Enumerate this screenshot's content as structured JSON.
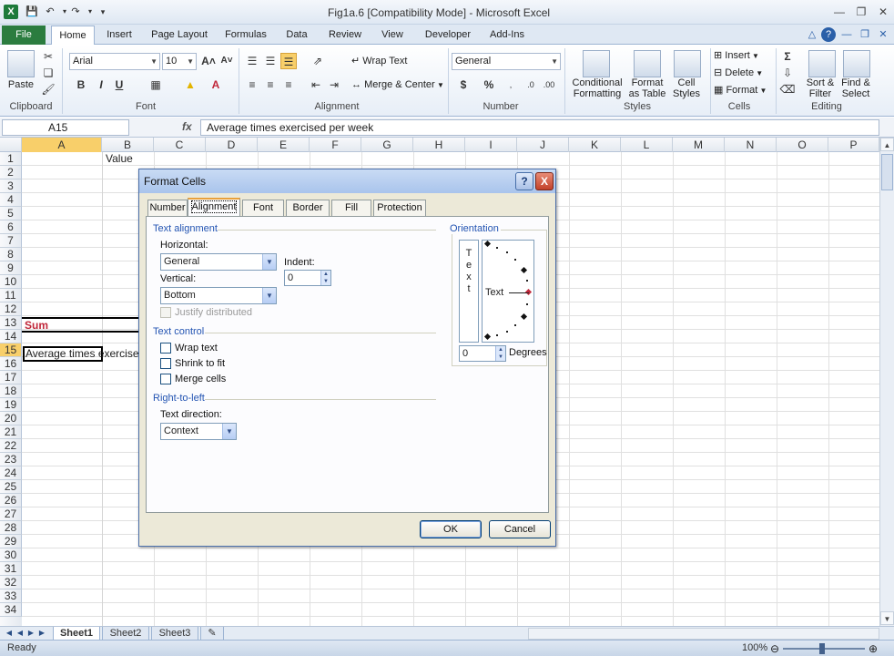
{
  "window": {
    "title": "Fig1a.6  [Compatibility Mode]  -  Microsoft Excel",
    "app_icon": "X"
  },
  "ribbon": {
    "file_tab": "File",
    "tabs": [
      "Home",
      "Insert",
      "Page Layout",
      "Formulas",
      "Data",
      "Review",
      "View",
      "Developer",
      "Add-Ins"
    ],
    "active_tab": "Home",
    "clipboard": {
      "paste": "Paste",
      "label": "Clipboard"
    },
    "font": {
      "name": "Arial",
      "size": "10",
      "label": "Font",
      "bold": "B",
      "italic": "I",
      "underline": "U"
    },
    "alignment": {
      "wrap_text": "Wrap Text",
      "merge_center": "Merge & Center",
      "label": "Alignment"
    },
    "number": {
      "format": "General",
      "currency": "$",
      "percent": "%",
      "label": "Number"
    },
    "styles": {
      "conditional": [
        "Conditional",
        "Formatting"
      ],
      "format_table": [
        "Format",
        "as Table"
      ],
      "cell_styles": [
        "Cell",
        "Styles"
      ],
      "label": "Styles"
    },
    "cells": {
      "insert": "Insert",
      "delete": "Delete",
      "format": "Format",
      "label": "Cells"
    },
    "editing": {
      "sort": [
        "Sort &",
        "Filter"
      ],
      "find": [
        "Find &",
        "Select"
      ],
      "label": "Editing"
    }
  },
  "formula_bar": {
    "name_box": "A15",
    "fx": "fx",
    "value": "Average times exercised per week"
  },
  "grid": {
    "columns": [
      "A",
      "B",
      "C",
      "D",
      "E",
      "F",
      "G",
      "H",
      "I",
      "J",
      "K",
      "L",
      "M",
      "N",
      "O",
      "P"
    ],
    "selected_column": "A",
    "rows": [
      "1",
      "2",
      "3",
      "4",
      "5",
      "6",
      "7",
      "8",
      "9",
      "10",
      "11",
      "12",
      "13",
      "14",
      "15",
      "16",
      "17",
      "18",
      "19",
      "20",
      "21",
      "22",
      "23",
      "24",
      "25",
      "26",
      "27",
      "28",
      "29",
      "30",
      "31",
      "32",
      "33",
      "34"
    ],
    "selected_row": "15",
    "b1": "Value",
    "a13": "Sum",
    "a15": "Average times exercised"
  },
  "sheets": {
    "tabs": [
      "Sheet1",
      "Sheet2",
      "Sheet3"
    ],
    "active": "Sheet1"
  },
  "status": {
    "text": "Ready",
    "zoom": "100%"
  },
  "dialog": {
    "title": "Format Cells",
    "help": "?",
    "close": "X",
    "tabs": [
      "Number",
      "Alignment",
      "Font",
      "Border",
      "Fill",
      "Protection"
    ],
    "active_tab": "Alignment",
    "text_alignment": {
      "section": "Text alignment",
      "horizontal_label": "Horizontal:",
      "horizontal_value": "General",
      "vertical_label": "Vertical:",
      "vertical_value": "Bottom",
      "indent_label": "Indent:",
      "indent_value": "0",
      "justify_distributed": "Justify distributed"
    },
    "text_control": {
      "section": "Text control",
      "wrap": "Wrap text",
      "shrink": "Shrink to fit",
      "merge": "Merge cells"
    },
    "rtl": {
      "section": "Right-to-left",
      "direction_label": "Text direction:",
      "direction_value": "Context"
    },
    "orientation": {
      "section": "Orientation",
      "vertical_text": [
        "T",
        "e",
        "x",
        "t"
      ],
      "dial_text": "Text",
      "degrees_value": "0",
      "degrees_label": "Degrees"
    },
    "ok": "OK",
    "cancel": "Cancel"
  }
}
